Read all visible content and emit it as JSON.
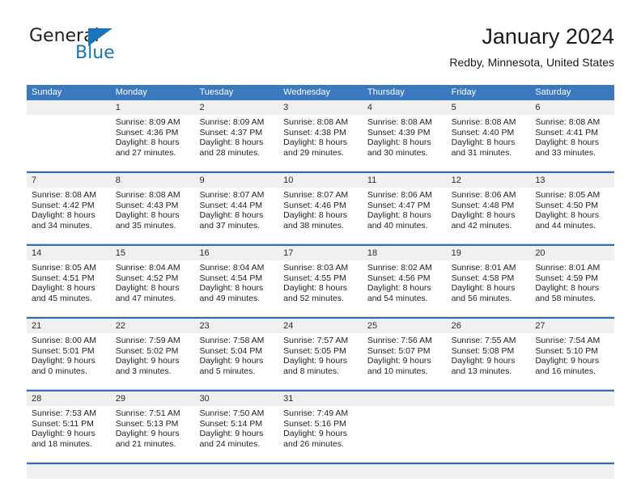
{
  "brand": {
    "name_top": "General",
    "name_bottom": "Blue",
    "accent_color": "#1b75bb"
  },
  "header": {
    "title": "January 2024",
    "subtitle": "Redby, Minnesota, United States"
  },
  "calendar": {
    "header_color": "#3a78bf",
    "rule_color": "#2f6cb3",
    "numbar_color": "#f0f0f0",
    "day_names": [
      "Sunday",
      "Monday",
      "Tuesday",
      "Wednesday",
      "Thursday",
      "Friday",
      "Saturday"
    ],
    "weeks": [
      [
        {
          "day": "",
          "sunrise": "",
          "sunset": "",
          "daylight_1": "",
          "daylight_2": ""
        },
        {
          "day": "1",
          "sunrise": "Sunrise: 8:09 AM",
          "sunset": "Sunset: 4:36 PM",
          "daylight_1": "Daylight: 8 hours",
          "daylight_2": "and 27 minutes."
        },
        {
          "day": "2",
          "sunrise": "Sunrise: 8:09 AM",
          "sunset": "Sunset: 4:37 PM",
          "daylight_1": "Daylight: 8 hours",
          "daylight_2": "and 28 minutes."
        },
        {
          "day": "3",
          "sunrise": "Sunrise: 8:08 AM",
          "sunset": "Sunset: 4:38 PM",
          "daylight_1": "Daylight: 8 hours",
          "daylight_2": "and 29 minutes."
        },
        {
          "day": "4",
          "sunrise": "Sunrise: 8:08 AM",
          "sunset": "Sunset: 4:39 PM",
          "daylight_1": "Daylight: 8 hours",
          "daylight_2": "and 30 minutes."
        },
        {
          "day": "5",
          "sunrise": "Sunrise: 8:08 AM",
          "sunset": "Sunset: 4:40 PM",
          "daylight_1": "Daylight: 8 hours",
          "daylight_2": "and 31 minutes."
        },
        {
          "day": "6",
          "sunrise": "Sunrise: 8:08 AM",
          "sunset": "Sunset: 4:41 PM",
          "daylight_1": "Daylight: 8 hours",
          "daylight_2": "and 33 minutes."
        }
      ],
      [
        {
          "day": "7",
          "sunrise": "Sunrise: 8:08 AM",
          "sunset": "Sunset: 4:42 PM",
          "daylight_1": "Daylight: 8 hours",
          "daylight_2": "and 34 minutes."
        },
        {
          "day": "8",
          "sunrise": "Sunrise: 8:08 AM",
          "sunset": "Sunset: 4:43 PM",
          "daylight_1": "Daylight: 8 hours",
          "daylight_2": "and 35 minutes."
        },
        {
          "day": "9",
          "sunrise": "Sunrise: 8:07 AM",
          "sunset": "Sunset: 4:44 PM",
          "daylight_1": "Daylight: 8 hours",
          "daylight_2": "and 37 minutes."
        },
        {
          "day": "10",
          "sunrise": "Sunrise: 8:07 AM",
          "sunset": "Sunset: 4:46 PM",
          "daylight_1": "Daylight: 8 hours",
          "daylight_2": "and 38 minutes."
        },
        {
          "day": "11",
          "sunrise": "Sunrise: 8:06 AM",
          "sunset": "Sunset: 4:47 PM",
          "daylight_1": "Daylight: 8 hours",
          "daylight_2": "and 40 minutes."
        },
        {
          "day": "12",
          "sunrise": "Sunrise: 8:06 AM",
          "sunset": "Sunset: 4:48 PM",
          "daylight_1": "Daylight: 8 hours",
          "daylight_2": "and 42 minutes."
        },
        {
          "day": "13",
          "sunrise": "Sunrise: 8:05 AM",
          "sunset": "Sunset: 4:50 PM",
          "daylight_1": "Daylight: 8 hours",
          "daylight_2": "and 44 minutes."
        }
      ],
      [
        {
          "day": "14",
          "sunrise": "Sunrise: 8:05 AM",
          "sunset": "Sunset: 4:51 PM",
          "daylight_1": "Daylight: 8 hours",
          "daylight_2": "and 45 minutes."
        },
        {
          "day": "15",
          "sunrise": "Sunrise: 8:04 AM",
          "sunset": "Sunset: 4:52 PM",
          "daylight_1": "Daylight: 8 hours",
          "daylight_2": "and 47 minutes."
        },
        {
          "day": "16",
          "sunrise": "Sunrise: 8:04 AM",
          "sunset": "Sunset: 4:54 PM",
          "daylight_1": "Daylight: 8 hours",
          "daylight_2": "and 49 minutes."
        },
        {
          "day": "17",
          "sunrise": "Sunrise: 8:03 AM",
          "sunset": "Sunset: 4:55 PM",
          "daylight_1": "Daylight: 8 hours",
          "daylight_2": "and 52 minutes."
        },
        {
          "day": "18",
          "sunrise": "Sunrise: 8:02 AM",
          "sunset": "Sunset: 4:56 PM",
          "daylight_1": "Daylight: 8 hours",
          "daylight_2": "and 54 minutes."
        },
        {
          "day": "19",
          "sunrise": "Sunrise: 8:01 AM",
          "sunset": "Sunset: 4:58 PM",
          "daylight_1": "Daylight: 8 hours",
          "daylight_2": "and 56 minutes."
        },
        {
          "day": "20",
          "sunrise": "Sunrise: 8:01 AM",
          "sunset": "Sunset: 4:59 PM",
          "daylight_1": "Daylight: 8 hours",
          "daylight_2": "and 58 minutes."
        }
      ],
      [
        {
          "day": "21",
          "sunrise": "Sunrise: 8:00 AM",
          "sunset": "Sunset: 5:01 PM",
          "daylight_1": "Daylight: 9 hours",
          "daylight_2": "and 0 minutes."
        },
        {
          "day": "22",
          "sunrise": "Sunrise: 7:59 AM",
          "sunset": "Sunset: 5:02 PM",
          "daylight_1": "Daylight: 9 hours",
          "daylight_2": "and 3 minutes."
        },
        {
          "day": "23",
          "sunrise": "Sunrise: 7:58 AM",
          "sunset": "Sunset: 5:04 PM",
          "daylight_1": "Daylight: 9 hours",
          "daylight_2": "and 5 minutes."
        },
        {
          "day": "24",
          "sunrise": "Sunrise: 7:57 AM",
          "sunset": "Sunset: 5:05 PM",
          "daylight_1": "Daylight: 9 hours",
          "daylight_2": "and 8 minutes."
        },
        {
          "day": "25",
          "sunrise": "Sunrise: 7:56 AM",
          "sunset": "Sunset: 5:07 PM",
          "daylight_1": "Daylight: 9 hours",
          "daylight_2": "and 10 minutes."
        },
        {
          "day": "26",
          "sunrise": "Sunrise: 7:55 AM",
          "sunset": "Sunset: 5:08 PM",
          "daylight_1": "Daylight: 9 hours",
          "daylight_2": "and 13 minutes."
        },
        {
          "day": "27",
          "sunrise": "Sunrise: 7:54 AM",
          "sunset": "Sunset: 5:10 PM",
          "daylight_1": "Daylight: 9 hours",
          "daylight_2": "and 16 minutes."
        }
      ],
      [
        {
          "day": "28",
          "sunrise": "Sunrise: 7:53 AM",
          "sunset": "Sunset: 5:11 PM",
          "daylight_1": "Daylight: 9 hours",
          "daylight_2": "and 18 minutes."
        },
        {
          "day": "29",
          "sunrise": "Sunrise: 7:51 AM",
          "sunset": "Sunset: 5:13 PM",
          "daylight_1": "Daylight: 9 hours",
          "daylight_2": "and 21 minutes."
        },
        {
          "day": "30",
          "sunrise": "Sunrise: 7:50 AM",
          "sunset": "Sunset: 5:14 PM",
          "daylight_1": "Daylight: 9 hours",
          "daylight_2": "and 24 minutes."
        },
        {
          "day": "31",
          "sunrise": "Sunrise: 7:49 AM",
          "sunset": "Sunset: 5:16 PM",
          "daylight_1": "Daylight: 9 hours",
          "daylight_2": "and 26 minutes."
        },
        {
          "day": "",
          "sunrise": "",
          "sunset": "",
          "daylight_1": "",
          "daylight_2": ""
        },
        {
          "day": "",
          "sunrise": "",
          "sunset": "",
          "daylight_1": "",
          "daylight_2": ""
        },
        {
          "day": "",
          "sunrise": "",
          "sunset": "",
          "daylight_1": "",
          "daylight_2": ""
        }
      ]
    ]
  }
}
